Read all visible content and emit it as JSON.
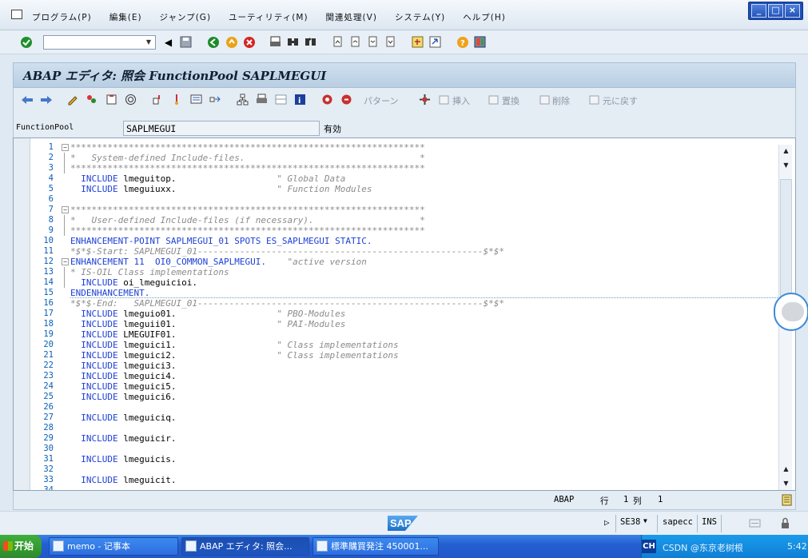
{
  "menubar": {
    "items": [
      "プログラム(P)",
      "編集(E)",
      "ジャンプ(G)",
      "ユーティリティ(M)",
      "関連処理(V)",
      "システム(Y)",
      "ヘルプ(H)"
    ]
  },
  "window_controls": {
    "minimize": "_",
    "restore": "□",
    "close": "×"
  },
  "command_field": {
    "value": "",
    "placeholder": ""
  },
  "title": "ABAP エディタ: 照会 FunctionPool SAPLMEGUI",
  "app_toolbar": {
    "pattern_label": "パターン",
    "insert_label": "挿入",
    "replace_label": "置換",
    "delete_label": "削除",
    "undo_label": "元に戻す"
  },
  "fields": {
    "label": "FunctionPool",
    "value": "SAPLMEGUI",
    "status": "有効"
  },
  "editor": {
    "lines": [
      {
        "n": "1",
        "text": "*******************************************************************",
        "kind": "cmt",
        "fold": "-"
      },
      {
        "n": "2",
        "text": "*   System-defined Include-files.                                 *",
        "kind": "cmt",
        "fold": "|"
      },
      {
        "n": "3",
        "text": "*******************************************************************",
        "kind": "cmt",
        "fold": "|"
      },
      {
        "n": "4",
        "text": "  INCLUDE lmeguitop.                   \" Global Data",
        "kind": "inc"
      },
      {
        "n": "5",
        "text": "  INCLUDE lmeguiuxx.                   \" Function Modules",
        "kind": "inc"
      },
      {
        "n": "6",
        "text": "",
        "kind": "blank"
      },
      {
        "n": "7",
        "text": "*******************************************************************",
        "kind": "cmt",
        "fold": "-"
      },
      {
        "n": "8",
        "text": "*   User-defined Include-files (if necessary).                    *",
        "kind": "cmt",
        "fold": "|"
      },
      {
        "n": "9",
        "text": "*******************************************************************",
        "kind": "cmt",
        "fold": "|"
      },
      {
        "n": "10",
        "text": "ENHANCEMENT-POINT SAPLMEGUI_01 SPOTS ES_SAPLMEGUI STATIC.",
        "kind": "enhpt"
      },
      {
        "n": "11",
        "text": "*$*$-Start: SAPLMEGUI_01------------------------------------------------------$*$*",
        "kind": "enh"
      },
      {
        "n": "12",
        "text": "ENHANCEMENT 11  OI0_COMMON_SAPLMEGUI.    \"active version",
        "kind": "enhbeg",
        "fold": "-"
      },
      {
        "n": "13",
        "text": "* IS-OIL Class implementations",
        "kind": "cmt",
        "fold": "|"
      },
      {
        "n": "14",
        "text": "  INCLUDE oi_lmeguicioi.",
        "kind": "inc",
        "fold": "|"
      },
      {
        "n": "15",
        "text": "ENDENHANCEMENT.",
        "kind": "enhend"
      },
      {
        "n": "16",
        "text": "*$*$-End:   SAPLMEGUI_01------------------------------------------------------$*$*",
        "kind": "enh"
      },
      {
        "n": "17",
        "text": "  INCLUDE lmeguio01.                   \" PBO-Modules",
        "kind": "inc"
      },
      {
        "n": "18",
        "text": "  INCLUDE lmeguii01.                   \" PAI-Modules",
        "kind": "inc"
      },
      {
        "n": "19",
        "text": "  INCLUDE LMEGUIF01.",
        "kind": "inc"
      },
      {
        "n": "20",
        "text": "  INCLUDE lmeguici1.                   \" Class implementations",
        "kind": "inc"
      },
      {
        "n": "21",
        "text": "  INCLUDE lmeguici2.                   \" Class implementations",
        "kind": "inc"
      },
      {
        "n": "22",
        "text": "  INCLUDE lmeguici3.",
        "kind": "inc"
      },
      {
        "n": "23",
        "text": "  INCLUDE lmeguici4.",
        "kind": "inc"
      },
      {
        "n": "24",
        "text": "  INCLUDE lmeguici5.",
        "kind": "inc"
      },
      {
        "n": "25",
        "text": "  INCLUDE lmeguici6.",
        "kind": "inc"
      },
      {
        "n": "26",
        "text": "",
        "kind": "blank"
      },
      {
        "n": "27",
        "text": "  INCLUDE lmeguiciq.",
        "kind": "inc"
      },
      {
        "n": "28",
        "text": "",
        "kind": "blank"
      },
      {
        "n": "29",
        "text": "  INCLUDE lmeguicir.",
        "kind": "inc"
      },
      {
        "n": "30",
        "text": "",
        "kind": "blank"
      },
      {
        "n": "31",
        "text": "  INCLUDE lmeguicis.",
        "kind": "inc"
      },
      {
        "n": "32",
        "text": "",
        "kind": "blank"
      },
      {
        "n": "33",
        "text": "  INCLUDE lmeguicit.",
        "kind": "inc"
      },
      {
        "n": "34",
        "text": "",
        "kind": "blank"
      }
    ]
  },
  "status": {
    "language": "ABAP",
    "line_label": "行",
    "line_value": "1",
    "col_label": "列",
    "col_value": "1"
  },
  "sapbar": {
    "logo": "SAP",
    "transaction": "SE38",
    "system": "sapecc",
    "mode": "INS"
  },
  "taskbar": {
    "start_label": "开始",
    "tasks": [
      "memo - 记事本",
      "ABAP エディタ: 照会...",
      "標準購買発注 450001..."
    ],
    "lang": "CH",
    "tray_text": "CSDN @东京老树根",
    "clock": "5:42"
  },
  "colors": {
    "keyword": "#1c3fd6",
    "comment": "#8b8b8b",
    "line_number": "#0a5fb4",
    "sap_blue": "#1a6fc7"
  }
}
